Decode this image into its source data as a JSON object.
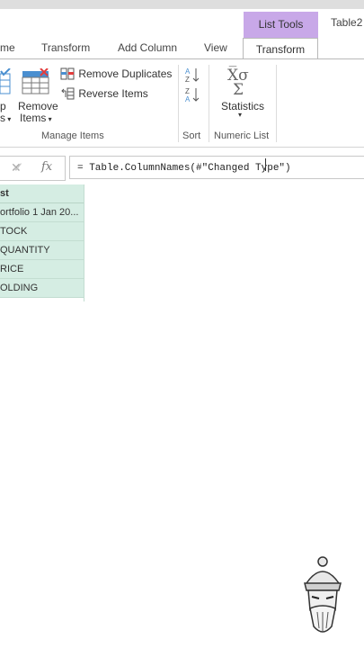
{
  "ribbon_tabs": {
    "home_fragment": "me",
    "transform": "Transform",
    "add_column": "Add Column",
    "view": "View",
    "context_group": "List Tools",
    "active_tab": "Transform",
    "window_title": "Table2"
  },
  "manage_items": {
    "keep_fragment_top": "p",
    "keep_fragment_bottom": "s",
    "remove_items_line1": "Remove",
    "remove_items_line2": "Items",
    "remove_duplicates": "Remove Duplicates",
    "reverse_items": "Reverse Items",
    "group_label": "Manage Items"
  },
  "sort": {
    "group_label": "Sort"
  },
  "numeric_list": {
    "statistics": "Statistics",
    "group_label": "Numeric List"
  },
  "formula_bar": {
    "fx": "fx",
    "formula": "= Table.ColumnNames(#\"Changed Type\")"
  },
  "list_preview": {
    "header": "st",
    "items": [
      "ortfolio 1 Jan 20...",
      "TOCK",
      "QUANTITY",
      "RICE",
      "OLDING"
    ]
  }
}
